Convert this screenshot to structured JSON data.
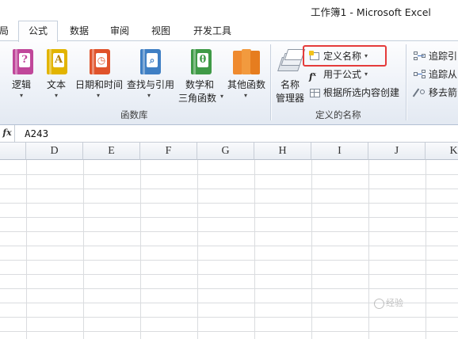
{
  "window": {
    "title": "工作簿1 - Microsoft Excel"
  },
  "tabs": [
    {
      "label": "局",
      "active": false
    },
    {
      "label": "公式",
      "active": true
    },
    {
      "label": "数据",
      "active": false
    },
    {
      "label": "审阅",
      "active": false
    },
    {
      "label": "视图",
      "active": false
    },
    {
      "label": "开发工具",
      "active": false
    }
  ],
  "ribbon": {
    "function_library": {
      "group_label": "函数库",
      "buttons": [
        {
          "label": "逻辑",
          "icon": "logical-book-icon",
          "color": "#c0479a",
          "glyph": "?"
        },
        {
          "label": "文本",
          "icon": "text-book-icon",
          "color": "#e2b400",
          "glyph": "A"
        },
        {
          "label": "日期和时间",
          "icon": "date-time-book-icon",
          "color": "#e0532b",
          "glyph": "◷"
        },
        {
          "label": "查找与引用",
          "icon": "lookup-book-icon",
          "color": "#3f7fc4",
          "glyph": "⌕"
        },
        {
          "label": "数学和",
          "label2": "三角函数",
          "icon": "math-trig-book-icon",
          "color": "#3f9a47",
          "glyph": "θ"
        },
        {
          "label": "其他函数",
          "icon": "more-functions-book-icon",
          "color": "#ef8a2e",
          "glyph": ""
        }
      ]
    },
    "defined_names": {
      "group_label": "定义的名称",
      "name_manager": {
        "label1": "名称",
        "label2": "管理器",
        "icon": "name-manager-icon"
      },
      "define_name": {
        "label": "定义名称",
        "icon": "define-name-icon",
        "highlight_color": "#e53b3b"
      },
      "use_in_formula": {
        "label": "用于公式",
        "icon": "use-in-formula-icon"
      },
      "create_from_selection": {
        "label": "根据所选内容创建",
        "icon": "create-from-selection-icon"
      }
    },
    "formula_auditing": {
      "trace_precedents": {
        "label": "追踪引",
        "icon": "trace-precedents-icon"
      },
      "trace_dependents": {
        "label": "追踪从",
        "icon": "trace-dependents-icon"
      },
      "remove_arrows": {
        "label": "移去箭",
        "icon": "remove-arrows-icon"
      }
    }
  },
  "formula_bar": {
    "fx_label": "fx",
    "value": "A243"
  },
  "sheet": {
    "columns": [
      "D",
      "E",
      "F",
      "G",
      "H",
      "I",
      "J",
      "K"
    ]
  },
  "watermark": {
    "text": "经验"
  }
}
